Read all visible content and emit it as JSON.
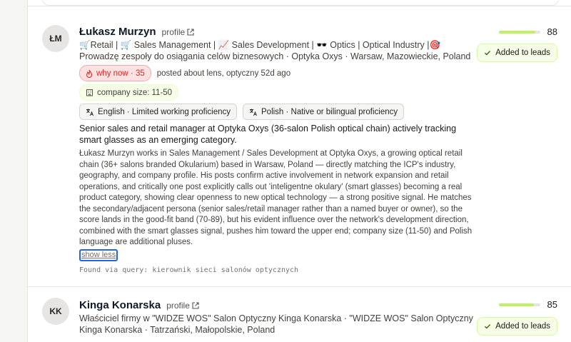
{
  "leads": [
    {
      "initials": "ŁM",
      "name": "Łukasz Murzyn",
      "profile_label": "profile",
      "headline": "🛒Retail | 🛒 Sales Management | 📈 Sales Development | 🕶️ Optics | Optical Industry |🎯Prowadzę zespoły do osiągania celów biznesowych · Optyka Oxys · Warsaw, Mazowieckie, Poland",
      "score": "88",
      "score_fraction": 0.88,
      "added_label": "Added to leads",
      "why_now_label": "why now · 35",
      "posted_text": "posted about lens, optyczny 52d ago",
      "company_size_label": "company size:",
      "company_size_value": "11-50",
      "languages": [
        "English · Limited working proficiency",
        "Polish · Native or bilingual proficiency"
      ],
      "summary": "Senior sales and retail manager at Optyka Oxys (36-salon Polish optical chain) actively tracking smart glasses as an emerging category.",
      "detail": "Łukasz Murzyn works in Sales Management / Sales Development at Optyka Oxys, a growing optical retail chain (36+ salons branded Okularium) based in Warsaw, Poland — directly matching the ICP's industry, geography, and company profile. His posts confirm active involvement in network expansion and retail operations, and critically one post explicitly calls out 'inteligentne okulary' (smart glasses) becoming a real product category, showing clear openness to new optical technology — a strong positive signal. He matches the secondary/adjacent persona (senior sales/retail manager rather than a named buyer or owner), so the score lands in the good-fit band (70-89), but his evident influence over the network's development direction, combined with the smart glasses signal, pushes him toward the upper end; company size (11-50) and Polish language are additional pluses.",
      "show_less_label": "show less",
      "found_label": "Found via query:",
      "found_query": "kierownik sieci salonów optycznych"
    },
    {
      "initials": "KK",
      "name": "Kinga Konarska",
      "profile_label": "profile",
      "headline": "Właściciel firmy w \"WIDZE WOS\" Salon Optyczny Kinga Konarska · \"WIDZE WOS\" Salon Optyczny Kinga Konarska · Tatrzański, Małopolskie, Poland",
      "score": "85",
      "score_fraction": 0.85,
      "added_label": "Added to leads"
    }
  ]
}
